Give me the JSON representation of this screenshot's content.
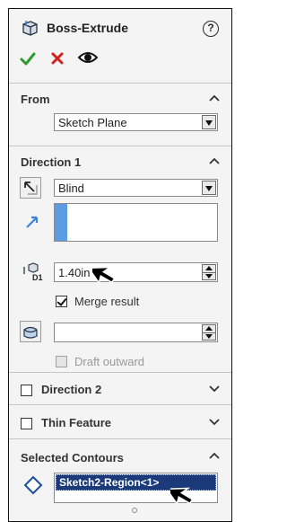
{
  "header": {
    "title": "Boss-Extrude",
    "help_symbol": "?",
    "icons": [
      "extrude-feature-icon",
      "ok-check-icon",
      "cancel-x-icon",
      "preview-eye-icon",
      "help-icon"
    ]
  },
  "from": {
    "title": "From",
    "start_condition": "Sketch Plane"
  },
  "direction1": {
    "title": "Direction 1",
    "end_condition": "Blind",
    "depth": "1.40in",
    "depth_tag": "D1",
    "merge_result_label": "Merge result",
    "merge_result_checked": true,
    "draft_value": "",
    "draft_outward_label": "Draft outward",
    "draft_outward_checked": false
  },
  "direction2": {
    "title": "Direction 2",
    "checked": false
  },
  "thin_feature": {
    "title": "Thin Feature",
    "checked": false
  },
  "selected_contours": {
    "title": "Selected Contours",
    "items": [
      "Sketch2-Region<1>"
    ]
  },
  "colors": {
    "panel_bg": "#f4f4f4",
    "selection_blue": "#1a3a7a",
    "accent_blue": "#3b83d6",
    "ok_green": "#2e9b2e",
    "cancel_red": "#d42020"
  }
}
